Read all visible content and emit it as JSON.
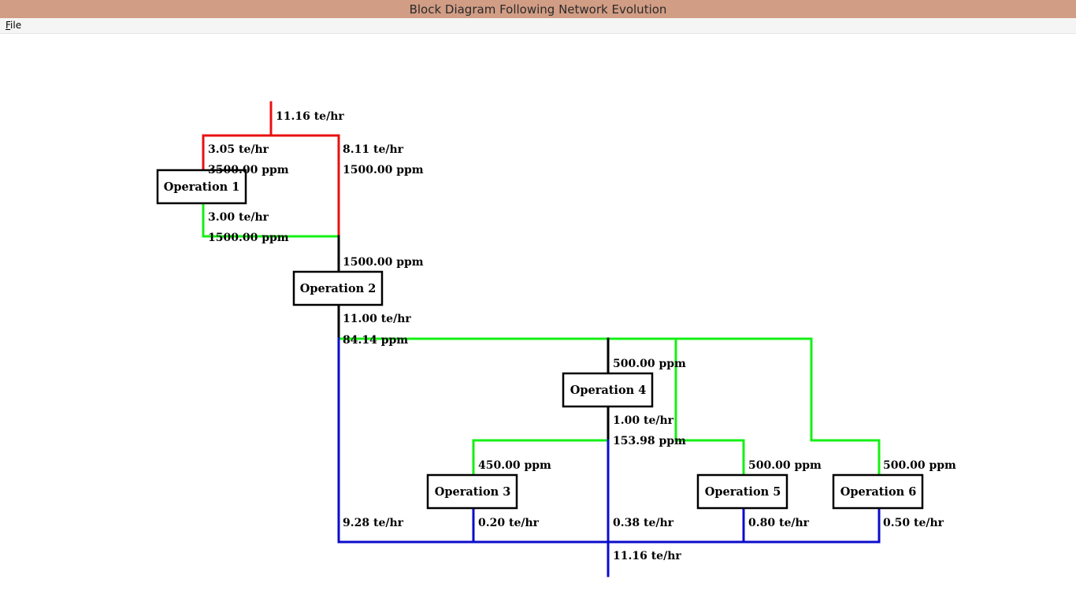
{
  "window": {
    "title": "Block Diagram Following Network Evolution"
  },
  "menu": {
    "file": {
      "accel": "F",
      "rest": "ile"
    }
  },
  "diagram": {
    "colors": {
      "freshwater": "#e81010",
      "reuse": "#14f014",
      "wastewater": "#0c0ccc",
      "outlet": "#000000"
    },
    "operations": {
      "op1": "Operation 1",
      "op2": "Operation 2",
      "op3": "Operation 3",
      "op4": "Operation 4",
      "op5": "Operation 5",
      "op6": "Operation 6"
    },
    "labels": {
      "fresh_total_flow": "11.16 te/hr",
      "op1_in_flow": "3.05 te/hr",
      "op1_in_conc": "3500.00 ppm",
      "fresh_branch_flow": "8.11 te/hr",
      "fresh_branch_conc": "1500.00 ppm",
      "op1_out_flow": "3.00 te/hr",
      "op1_out_conc": "1500.00 ppm",
      "op2_in_conc": "1500.00 ppm",
      "op2_out_flow": "11.00 te/hr",
      "op2_out_conc": "84.14 ppm",
      "op4_in_conc": "500.00 ppm",
      "op4_out_flow": "1.00 te/hr",
      "op4_out_conc": "153.98 ppm",
      "op3_in_conc": "450.00 ppm",
      "op5_in_conc": "500.00 ppm",
      "op6_in_conc": "500.00 ppm",
      "ww_direct_flow": "9.28 te/hr",
      "op3_ww_flow": "0.20 te/hr",
      "op4_ww_flow": "0.38 te/hr",
      "op5_ww_flow": "0.80 te/hr",
      "op6_ww_flow": "0.50 te/hr",
      "ww_total_flow": "11.16 te/hr"
    }
  }
}
